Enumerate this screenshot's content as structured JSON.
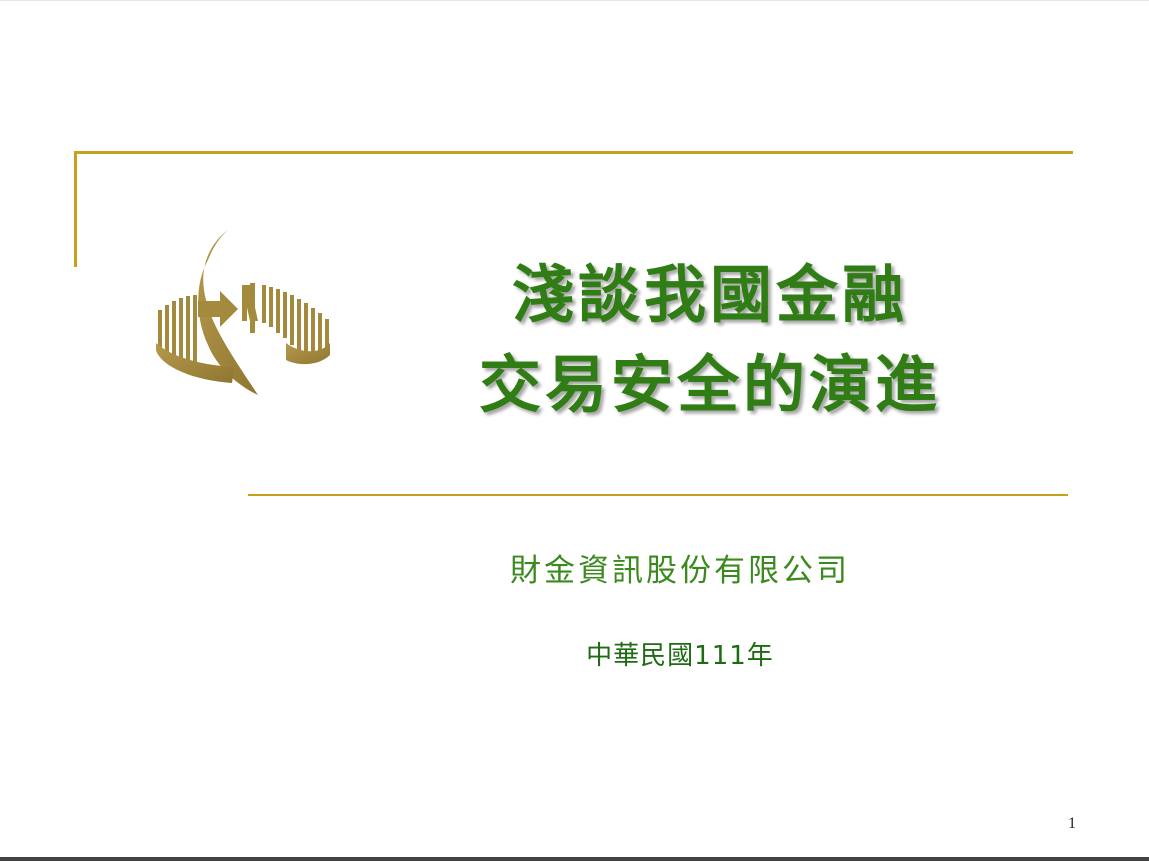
{
  "slide": {
    "title_line1": "淺談我國金融",
    "title_line2": "交易安全的演進",
    "company": "財金資訊股份有限公司",
    "date": "中華民國111年",
    "page_number": "1"
  },
  "logo": {
    "icon": "fisc-logo-icon",
    "color": "#a48a3d"
  },
  "colors": {
    "accent_line": "#c9a01a",
    "title_green": "#2f7d14",
    "subtitle_green": "#3b8a1e"
  }
}
